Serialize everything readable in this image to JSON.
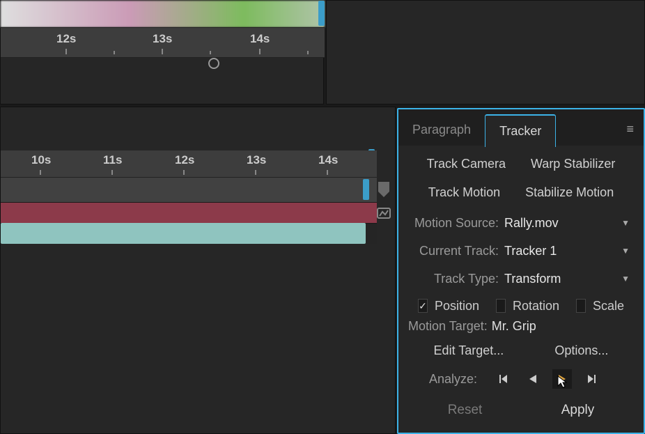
{
  "timeline_top": {
    "ticks": [
      "12s",
      "13s",
      "14s"
    ],
    "positions": [
      80,
      218,
      358
    ]
  },
  "timeline_main": {
    "ticks": [
      "10s",
      "11s",
      "12s",
      "13s",
      "14s"
    ],
    "positions": [
      44,
      147,
      250,
      353,
      456
    ]
  },
  "panel": {
    "tabs": {
      "paragraph": "Paragraph",
      "tracker": "Tracker"
    },
    "buttons": {
      "track_camera": "Track Camera",
      "warp_stabilizer": "Warp Stabilizer",
      "track_motion": "Track Motion",
      "stabilize_motion": "Stabilize Motion"
    },
    "motion_source": {
      "label": "Motion Source:",
      "value": "Rally.mov"
    },
    "current_track": {
      "label": "Current Track:",
      "value": "Tracker 1"
    },
    "track_type": {
      "label": "Track Type:",
      "value": "Transform"
    },
    "checks": {
      "position": "Position",
      "rotation": "Rotation",
      "scale": "Scale"
    },
    "motion_target": {
      "label": "Motion Target:",
      "value": "Mr. Grip"
    },
    "edit_target": "Edit Target...",
    "options": "Options...",
    "analyze": "Analyze:",
    "reset": "Reset",
    "apply": "Apply"
  }
}
